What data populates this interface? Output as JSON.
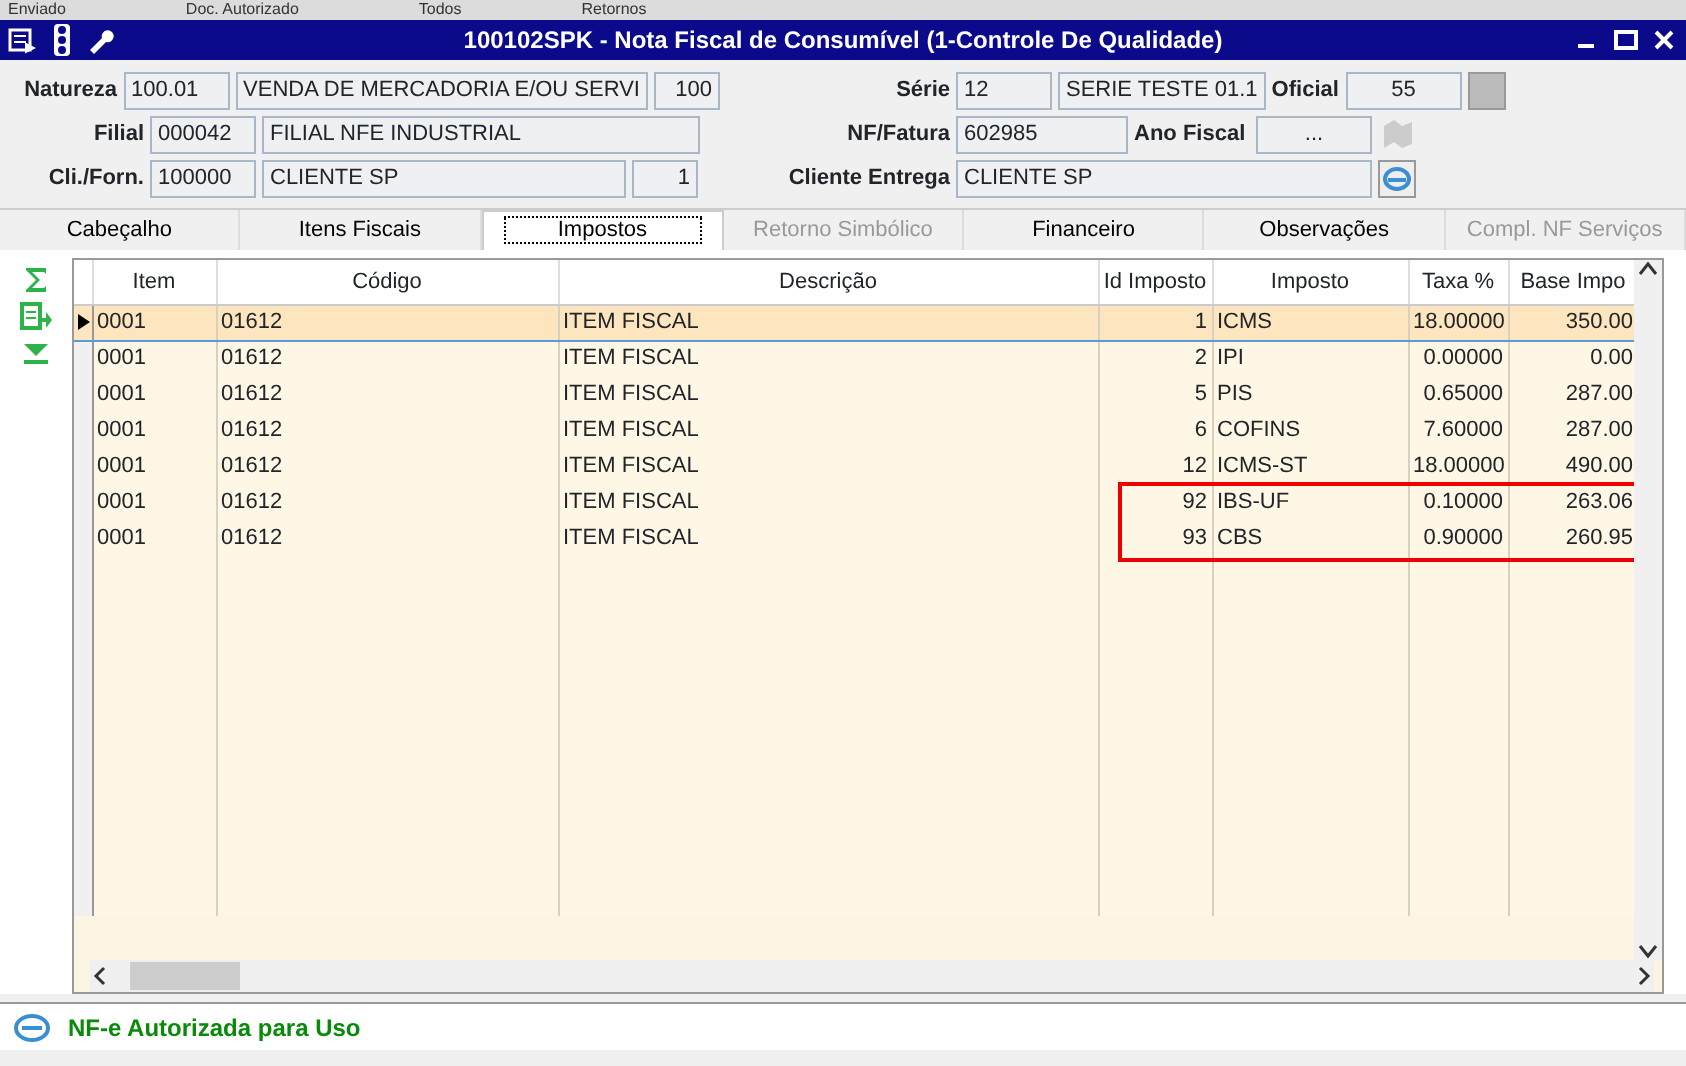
{
  "background_strip": [
    "Enviado",
    "Doc. Autorizado",
    "Todos",
    "Retornos"
  ],
  "window": {
    "title": "100102SPK - Nota Fiscal de Consumível (1-Controle De Qualidade)"
  },
  "form": {
    "left": [
      {
        "label": "Natureza",
        "fields": [
          "100.01",
          "VENDA DE MERCADORIA E/OU SERVI",
          "100"
        ]
      },
      {
        "label": "Filial",
        "fields": [
          "000042",
          "FILIAL NFE INDUSTRIAL"
        ]
      },
      {
        "label": "Cli./Forn.",
        "fields": [
          "100000",
          "CLIENTE SP",
          "1"
        ]
      }
    ],
    "right": [
      {
        "label": "Série",
        "fields": [
          "12",
          "SERIE TESTE 01.1"
        ],
        "label2": "Oficial",
        "field2": "55"
      },
      {
        "label": "NF/Fatura",
        "fields": [
          "602985"
        ],
        "label2": "Ano Fiscal",
        "field2": "..."
      },
      {
        "label": "Cliente Entrega",
        "fields": [
          "CLIENTE SP"
        ]
      }
    ]
  },
  "tabs": [
    {
      "label": "Cabeçalho",
      "selected": false,
      "disabled": false
    },
    {
      "label": "Itens Fiscais",
      "selected": false,
      "disabled": false
    },
    {
      "label": "Impostos",
      "selected": true,
      "disabled": false
    },
    {
      "label": "Retorno Simbólico",
      "selected": false,
      "disabled": true
    },
    {
      "label": "Financeiro",
      "selected": false,
      "disabled": false
    },
    {
      "label": "Observações",
      "selected": false,
      "disabled": false
    },
    {
      "label": "Compl. NF Serviços",
      "selected": false,
      "disabled": true
    }
  ],
  "table": {
    "columns": [
      "Item",
      "Código",
      "Descrição",
      "Id Imposto",
      "Imposto",
      "Taxa %",
      "Base Impo"
    ],
    "rows": [
      {
        "cells": [
          "0001",
          "01612",
          "ITEM FISCAL",
          "1",
          "ICMS",
          "18.00000",
          "350.00"
        ],
        "selected": true,
        "highlighted": false
      },
      {
        "cells": [
          "0001",
          "01612",
          "ITEM FISCAL",
          "2",
          "IPI",
          "0.00000",
          "0.00"
        ],
        "selected": false,
        "highlighted": false
      },
      {
        "cells": [
          "0001",
          "01612",
          "ITEM FISCAL",
          "5",
          "PIS",
          "0.65000",
          "287.00"
        ],
        "selected": false,
        "highlighted": false
      },
      {
        "cells": [
          "0001",
          "01612",
          "ITEM FISCAL",
          "6",
          "COFINS",
          "7.60000",
          "287.00"
        ],
        "selected": false,
        "highlighted": false
      },
      {
        "cells": [
          "0001",
          "01612",
          "ITEM FISCAL",
          "12",
          "ICMS-ST",
          "18.00000",
          "490.00"
        ],
        "selected": false,
        "highlighted": false
      },
      {
        "cells": [
          "0001",
          "01612",
          "ITEM FISCAL",
          "92",
          "IBS-UF",
          "0.10000",
          "263.06"
        ],
        "selected": false,
        "highlighted": true
      },
      {
        "cells": [
          "0001",
          "01612",
          "ITEM FISCAL",
          "93",
          "CBS",
          "0.90000",
          "260.95"
        ],
        "selected": false,
        "highlighted": true
      }
    ]
  },
  "status_bar": {
    "text": "NF-e Autorizada para Uso"
  }
}
